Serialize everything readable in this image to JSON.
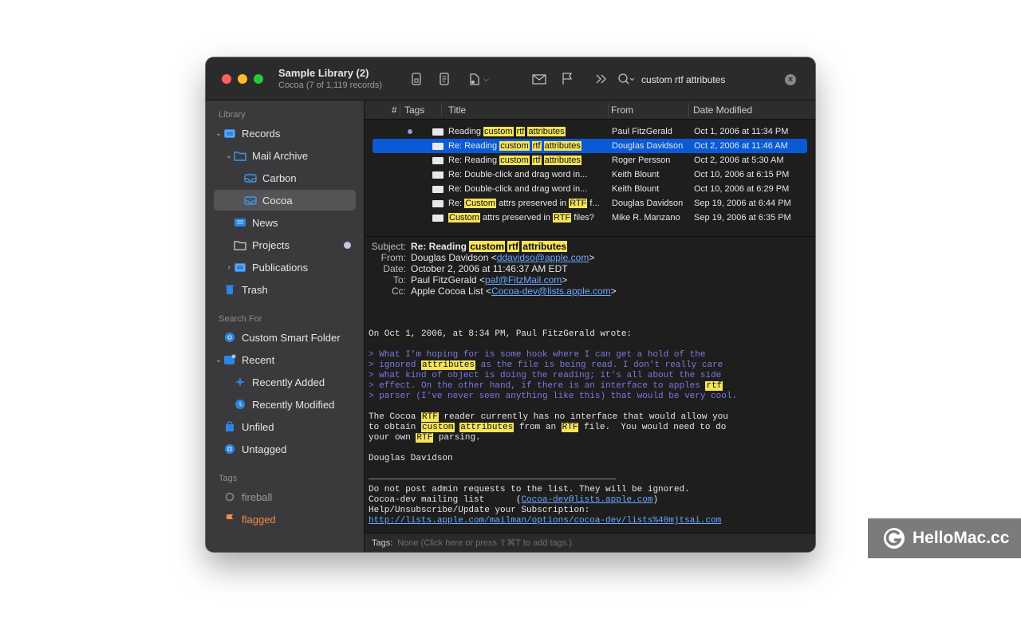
{
  "window": {
    "title": "Sample Library (2)",
    "subtitle": "Cocoa (7 of 1,119 records)"
  },
  "search": {
    "query": "custom rtf attributes"
  },
  "sidebar": {
    "sections": {
      "library": "Library",
      "search_for": "Search For",
      "tags": "Tags"
    },
    "items": {
      "records": "Records",
      "mail_archive": "Mail Archive",
      "carbon": "Carbon",
      "cocoa": "Cocoa",
      "news": "News",
      "projects": "Projects",
      "publications": "Publications",
      "trash": "Trash",
      "custom_smart_folder": "Custom Smart Folder",
      "recent": "Recent",
      "recently_added": "Recently Added",
      "recently_modified": "Recently Modified",
      "unfiled": "Unfiled",
      "untagged": "Untagged",
      "fireball": "fireball",
      "flagged": "flagged"
    },
    "colors": {
      "selected_bg": "#545456",
      "flagged": "#f28a4a",
      "projects_dot": "#c7c4e6"
    }
  },
  "table": {
    "columns": {
      "num": "#",
      "tags": "Tags",
      "title": "Title",
      "from": "From",
      "date": "Date Modified"
    },
    "rows": [
      {
        "prefix": "Reading ",
        "hl": [
          "custom",
          "rtf",
          "attributes"
        ],
        "suffix": "",
        "from": "Paul FitzGerald",
        "date": "Oct 1, 2006 at 11:34 PM"
      },
      {
        "prefix": "Re: Reading ",
        "hl": [
          "custom",
          "rtf",
          "attributes"
        ],
        "suffix": "",
        "from": "Douglas Davidson",
        "date": "Oct 2, 2006 at 11:46 AM"
      },
      {
        "prefix": "Re: Reading ",
        "hl": [
          "custom",
          "rtf",
          "attributes"
        ],
        "suffix": "",
        "from": "Roger Persson",
        "date": "Oct 2, 2006 at 5:30 AM"
      },
      {
        "text": "Re: Double-click and drag word in...",
        "from": "Keith Blount",
        "date": "Oct 10, 2006 at 6:15 PM"
      },
      {
        "text": "Re: Double-click and drag word in...",
        "from": "Keith Blount",
        "date": "Oct 10, 2006 at 6:29 PM"
      },
      {
        "pre": "Re: ",
        "h1": "Custom",
        "mid": " attrs preserved in ",
        "h2": "RTF",
        "post": " f...",
        "from": "Douglas Davidson",
        "date": "Sep 19, 2006 at 6:44 PM"
      },
      {
        "pre": "",
        "h1": "Custom",
        "mid": " attrs preserved in ",
        "h2": "RTF",
        "post": " files?",
        "from": "Mike R. Manzano",
        "date": "Sep 19, 2006 at 6:35 PM"
      }
    ],
    "selected_color": "#0a5ad6",
    "highlight_color": "#f5e35a"
  },
  "message": {
    "labels": {
      "subject": "Subject:",
      "from": "From:",
      "date": "Date:",
      "to": "To:",
      "cc": "Cc:"
    },
    "subject_prefix": "Re: Reading ",
    "subject_hl": [
      "custom",
      "rtf",
      "attributes"
    ],
    "from_name": "Douglas Davidson <",
    "from_email": "ddavidso@apple.com",
    "from_close": ">",
    "date": "October 2, 2006 at 11:46:37 AM EDT",
    "to_name": "Paul FitzGerald <",
    "to_email": "paf@FitzMail.com",
    "to_close": ">",
    "cc_name": "Apple Cocoa List <",
    "cc_email": "Cocoa-dev@lists.apple.com",
    "cc_close": ">",
    "wrote": "On Oct 1, 2006, at 8:34 PM, Paul FitzGerald wrote:",
    "quote": {
      "l1": "> What I'm hoping for is some hook where I can get a hold of the",
      "l2a": "> ignored ",
      "l2h": "attributes",
      "l2b": " as the file is being read. I don't really care",
      "l3": "> what kind of object is doing the reading; it's all about the side",
      "l4a": "> effect. On the other hand, if there is an interface to apples ",
      "l4h": "rtf",
      "l5": "> parser (I've never seen anything like this) that would be very cool."
    },
    "reply": {
      "l1a": "The Cocoa ",
      "l1h": "RTF",
      "l1b": " reader currently has no interface that would allow you",
      "l2a": "to obtain ",
      "l2h1": "custom",
      "l2m": " ",
      "l2h2": "attributes",
      "l2b": " from an ",
      "l2h3": "RTF",
      "l2c": " file.  You would need to do",
      "l3a": "your own ",
      "l3h": "RTF",
      "l3b": " parsing."
    },
    "signature": "Douglas Davidson",
    "rule": "_______________________________________________",
    "footer": {
      "l1": "Do not post admin requests to the list. They will be ignored.",
      "l2a": "Cocoa-dev mailing list      (",
      "l2link": "Cocoa-dev@lists.apple.com",
      "l2b": ")",
      "l3": "Help/Unsubscribe/Update your Subscription:",
      "l4link": "http://lists.apple.com/mailman/options/cocoa-dev/lists%40mjtsai.com"
    }
  },
  "tagsbar": {
    "label": "Tags:",
    "placeholder": "None (Click here or press ⇧⌘T to add tags.)"
  },
  "watermark": {
    "text": "HelloMac.cc"
  }
}
